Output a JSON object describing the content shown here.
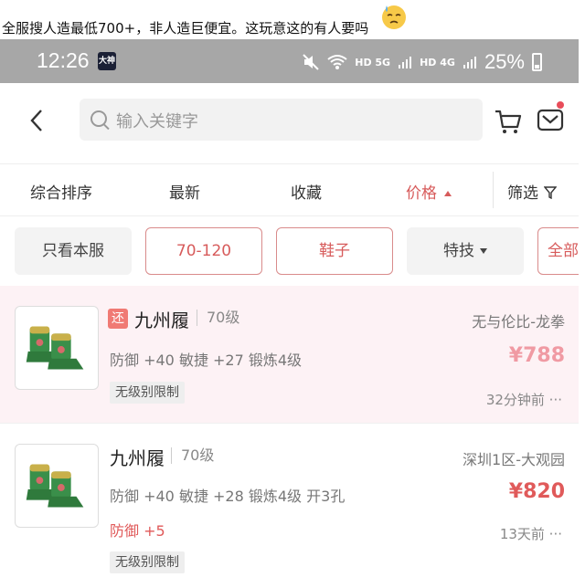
{
  "caption": {
    "text": "全服搜人造最低700+，非人造巨便宜。这玩意这的有人要吗",
    "emoji": "sweat-face-emoji"
  },
  "status_bar": {
    "time": "12:26",
    "app_badge": "大神",
    "network1": "HD 5G",
    "network2": "HD 4G",
    "battery": "25%"
  },
  "header": {
    "back_icon": "chevron-left-icon",
    "search_placeholder": "输入关键字",
    "cart_icon": "cart-icon",
    "mail_icon": "mail-icon"
  },
  "sort_bar": {
    "items": [
      "综合排序",
      "最新",
      "收藏",
      "价格"
    ],
    "filter": "筛选"
  },
  "chips": [
    "只看本服",
    "70-120",
    "鞋子",
    "特技",
    "全部"
  ],
  "items": [
    {
      "badge": "还",
      "name": "九州履",
      "level": "70级",
      "server": "无与伦比-龙拳",
      "attrs": "防御 +40 敏捷 +27 锻炼4级",
      "price": "¥788",
      "tag": "无级别限制",
      "time": "32分钟前 ···"
    },
    {
      "name": "九州履",
      "level": "70级",
      "server": "深圳1区-大观园",
      "attrs": "防御 +40 敏捷 +28 锻炼4级 开3孔",
      "price": "¥820",
      "bonus": "防御 +5",
      "tag": "无级别限制",
      "time": "13天前 ···"
    }
  ],
  "colors": {
    "accent": "#d75b5b",
    "highlight_row": "#fdf2f5",
    "status_bar": "#a7a7a7"
  }
}
